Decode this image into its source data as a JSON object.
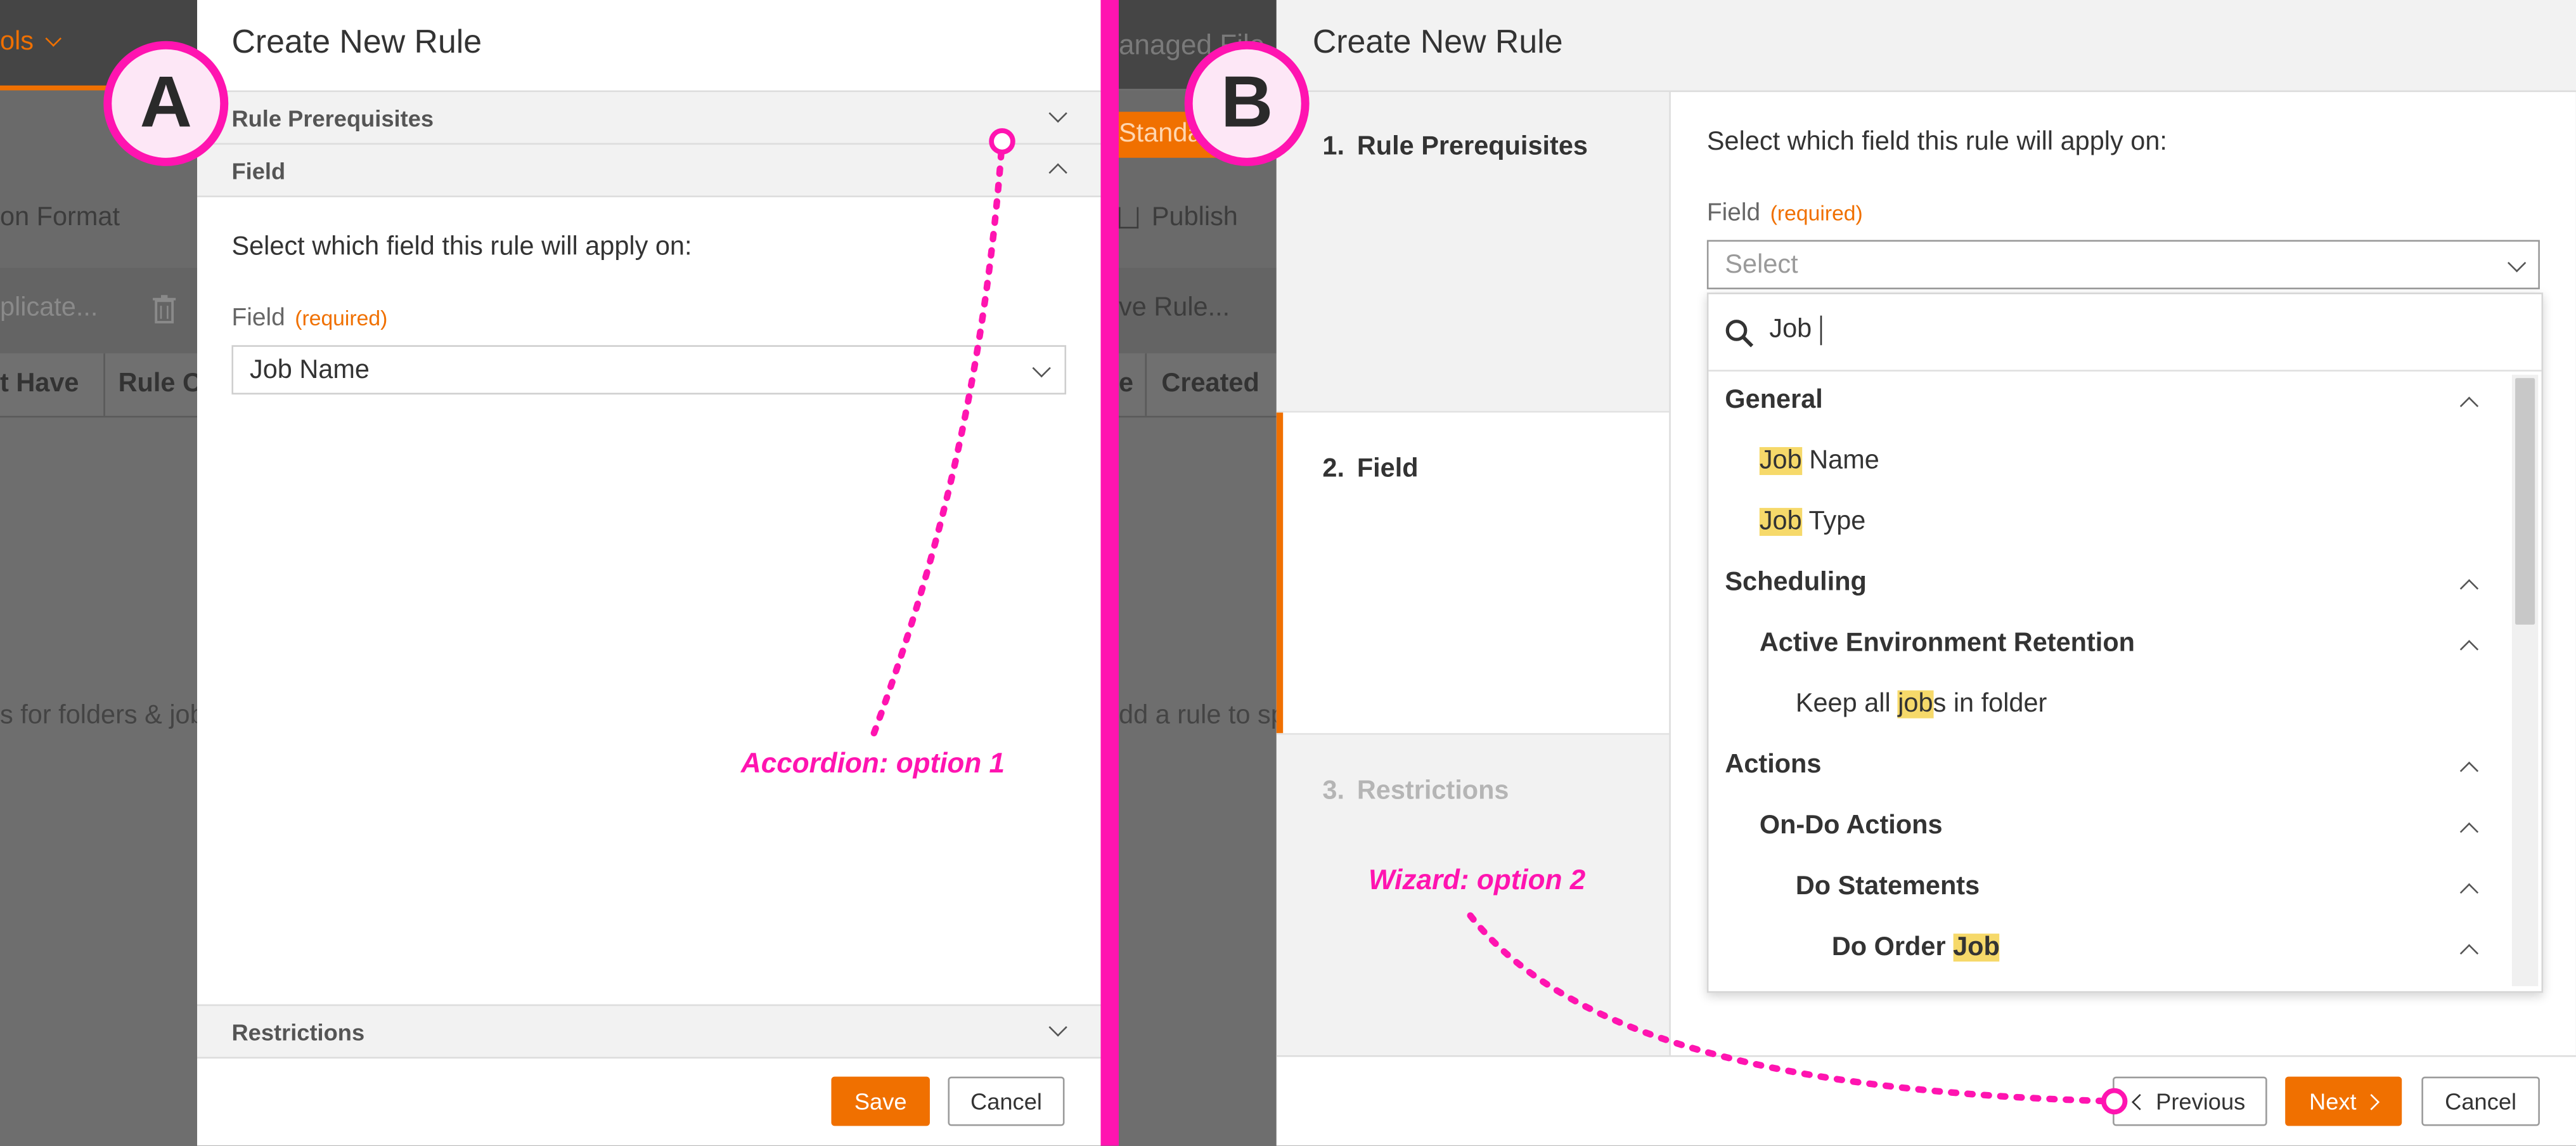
{
  "background": {
    "menu_fragment": "ols",
    "format_fragment": "on Format",
    "duplicate_fragment": "plicate...",
    "col_must_have": "t Have",
    "col_rule_fragment": "Rule Co",
    "empty_fragment": "s for folders & job",
    "managed_fragment": "anaged File",
    "standard_fragment": "Standa",
    "publish_label": "Publish",
    "remove_rule_fragment": "ve Rule...",
    "col_created": "Created",
    "add_rule_fragment": "dd a rule to sp",
    "col_e_fragment": "e"
  },
  "panel_a": {
    "badge": "A",
    "title": "Create New Rule",
    "accordion_prereq": "Rule Prerequisites",
    "accordion_field": "Field",
    "accordion_restrictions": "Restrictions",
    "instruction": "Select which field this rule will apply on:",
    "field_label": "Field",
    "required_label": "(required)",
    "field_value": "Job Name",
    "save_label": "Save",
    "cancel_label": "Cancel",
    "annotation": "Accordion: option 1"
  },
  "panel_b": {
    "badge": "B",
    "title": "Create New Rule",
    "steps": [
      {
        "num": "1.",
        "label": "Rule Prerequisites"
      },
      {
        "num": "2.",
        "label": "Field"
      },
      {
        "num": "3.",
        "label": "Restrictions"
      }
    ],
    "instruction": "Select which field this rule will apply on:",
    "field_label": "Field",
    "required_label": "(required)",
    "select_placeholder": "Select",
    "search_value": "Job",
    "dropdown": {
      "general": "General",
      "job_name_hl": "Job",
      "job_name_rest": " Name",
      "job_type_hl": "Job",
      "job_type_rest": " Type",
      "scheduling": "Scheduling",
      "active_env": "Active Environment Retention",
      "keep_pre": "Keep all ",
      "keep_hl": "job",
      "keep_post": "s in folder",
      "actions": "Actions",
      "on_do": "On-Do Actions",
      "do_statements": "Do Statements",
      "do_order_pre": "Do Order ",
      "do_order_hl": "Job"
    },
    "previous_label": "Previous",
    "next_label": "Next",
    "cancel_label": "Cancel",
    "annotation": "Wizard: option 2"
  },
  "colors": {
    "accent": "#f07000",
    "annotation": "#ff14b0",
    "highlight": "#f6d96a"
  }
}
